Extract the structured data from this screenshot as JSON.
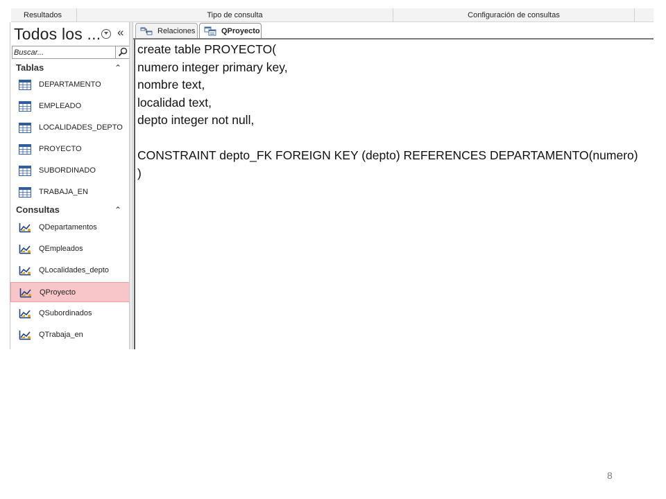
{
  "ribbon": {
    "groups": [
      "Resultados",
      "Tipo de consulta",
      "Configuración de consultas"
    ]
  },
  "nav": {
    "title": "Todos los ...",
    "search_placeholder": "Buscar...",
    "groups": [
      {
        "label": "Tablas",
        "items": [
          {
            "label": "DEPARTAMENTO",
            "icon": "table-icon"
          },
          {
            "label": "EMPLEADO",
            "icon": "table-icon"
          },
          {
            "label": "LOCALIDADES_DEPTO",
            "icon": "table-icon"
          },
          {
            "label": "PROYECTO",
            "icon": "table-icon"
          },
          {
            "label": "SUBORDINADO",
            "icon": "table-icon"
          },
          {
            "label": "TRABAJA_EN",
            "icon": "table-icon"
          }
        ]
      },
      {
        "label": "Consultas",
        "items": [
          {
            "label": "QDepartamentos",
            "icon": "query-icon"
          },
          {
            "label": "QEmpleados",
            "icon": "query-icon"
          },
          {
            "label": "QLocalidades_depto",
            "icon": "query-icon"
          },
          {
            "label": "QProyecto",
            "icon": "query-icon",
            "selected": true
          },
          {
            "label": "QSubordinados",
            "icon": "query-icon"
          },
          {
            "label": "QTrabaja_en",
            "icon": "query-icon"
          }
        ]
      }
    ],
    "selected_color": "#f8c6c8"
  },
  "tabs": [
    {
      "label": "Relaciones",
      "icon": "relationships-icon",
      "active": false
    },
    {
      "label": "QProyecto",
      "icon": "query-tab-icon",
      "active": true
    }
  ],
  "editor": {
    "lines": [
      "create table PROYECTO(",
      "numero integer primary key,",
      "nombre text,",
      "localidad text,",
      "depto integer not null,",
      "",
      "CONSTRAINT depto_FK FOREIGN KEY (depto) REFERENCES DEPARTAMENTO(numero)",
      ")"
    ]
  },
  "page_number": "8"
}
